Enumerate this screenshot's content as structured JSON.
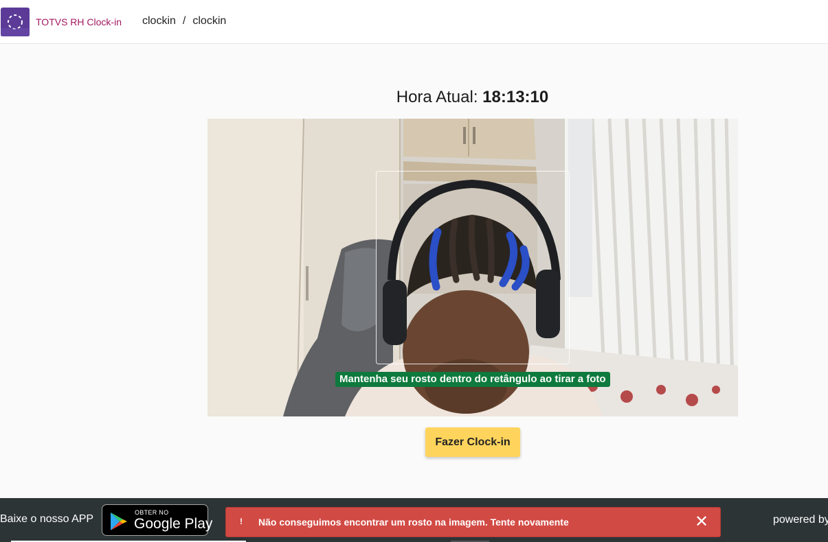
{
  "header": {
    "app_title": "TOTVS RH Clock-in",
    "breadcrumb": [
      "clockin",
      "clockin"
    ],
    "breadcrumb_separator": "/",
    "logo_icon": "dashed-circle-icon"
  },
  "main": {
    "clock_label": "Hora Atual:",
    "clock_time": "18:13:10",
    "camera_hint": "Mantenha seu rosto dentro do retângulo ao tirar a foto",
    "clockin_button": "Fazer Clock-in"
  },
  "footer": {
    "download_text": "Baixe o nosso APP",
    "store_small": "OBTER NO",
    "store_big": "Google Play",
    "toast_icon": "!",
    "toast_message": "Não conseguimos encontrar um rosto na imagem. Tente novamente",
    "toast_close": "✕",
    "powered_by": "powered by"
  },
  "colors": {
    "brand": "#5b3b97",
    "title_text": "#a2185f",
    "button": "#ffd45c",
    "hint_bg": "#0e7a3d",
    "footer_bg": "#2d3436",
    "toast_bg": "#d24a44"
  }
}
